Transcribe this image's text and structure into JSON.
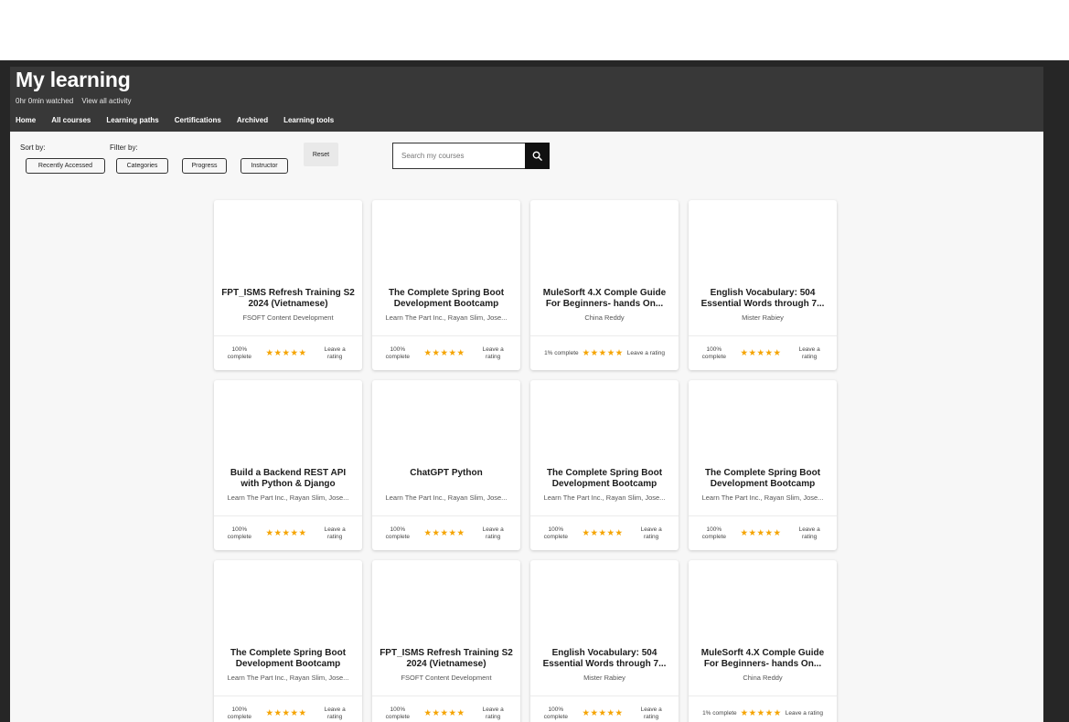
{
  "header": {
    "title": "My learning",
    "watched": "0hr 0min watched",
    "view_all": "View all activity",
    "nav": [
      "Home",
      "All courses",
      "Learning paths",
      "Certifications",
      "Archived",
      "Learning tools"
    ]
  },
  "controls": {
    "sort_label": "Sort by:",
    "filter_label": "Filter by:",
    "sort_value": "Recently Accessed",
    "filters": [
      "Categories",
      "Progress",
      "Instructor"
    ],
    "reset": "Reset",
    "search_placeholder": "Search my courses"
  },
  "rating_label": "Leave a rating",
  "stars": "★★★★★",
  "accent_color": "#f5a300",
  "courses": [
    {
      "title": "FPT_ISMS Refresh Training S2 2024 (Vietnamese)",
      "author": "FSOFT Content Development",
      "progress": "100% complete"
    },
    {
      "title": "The Complete Spring Boot Development Bootcamp",
      "author": "Learn The Part Inc., Rayan Slim, Jose...",
      "progress": "100% complete"
    },
    {
      "title": "MuleSorft 4.X Comple Guide For Beginners- hands On...",
      "author": "China Reddy",
      "progress": "1% complete"
    },
    {
      "title": "English Vocabulary: 504 Essential Words through 7...",
      "author": "Mister Rabiey",
      "progress": "100% complete"
    },
    {
      "title": "Build a Backend REST API with Python & Django",
      "author": "Learn The Part Inc., Rayan Slim, Jose...",
      "progress": "100% complete"
    },
    {
      "title": "ChatGPT Python",
      "author": "Learn The Part Inc., Rayan Slim, Jose...",
      "progress": "100% complete"
    },
    {
      "title": "The Complete Spring Boot Development Bootcamp",
      "author": "Learn The Part Inc., Rayan Slim, Jose...",
      "progress": "100% complete"
    },
    {
      "title": "The Complete Spring Boot Development Bootcamp",
      "author": "Learn The Part Inc., Rayan Slim, Jose...",
      "progress": "100% complete"
    },
    {
      "title": "The Complete Spring Boot Development Bootcamp",
      "author": "Learn The Part Inc., Rayan Slim, Jose...",
      "progress": "100% complete"
    },
    {
      "title": "FPT_ISMS Refresh Training S2 2024 (Vietnamese)",
      "author": "FSOFT Content Development",
      "progress": "100% complete"
    },
    {
      "title": "English Vocabulary: 504 Essential Words through 7...",
      "author": "Mister Rabiey",
      "progress": "100% complete"
    },
    {
      "title": "MuleSorft 4.X Comple Guide For Beginners- hands On...",
      "author": "China Reddy",
      "progress": "1% complete"
    }
  ]
}
